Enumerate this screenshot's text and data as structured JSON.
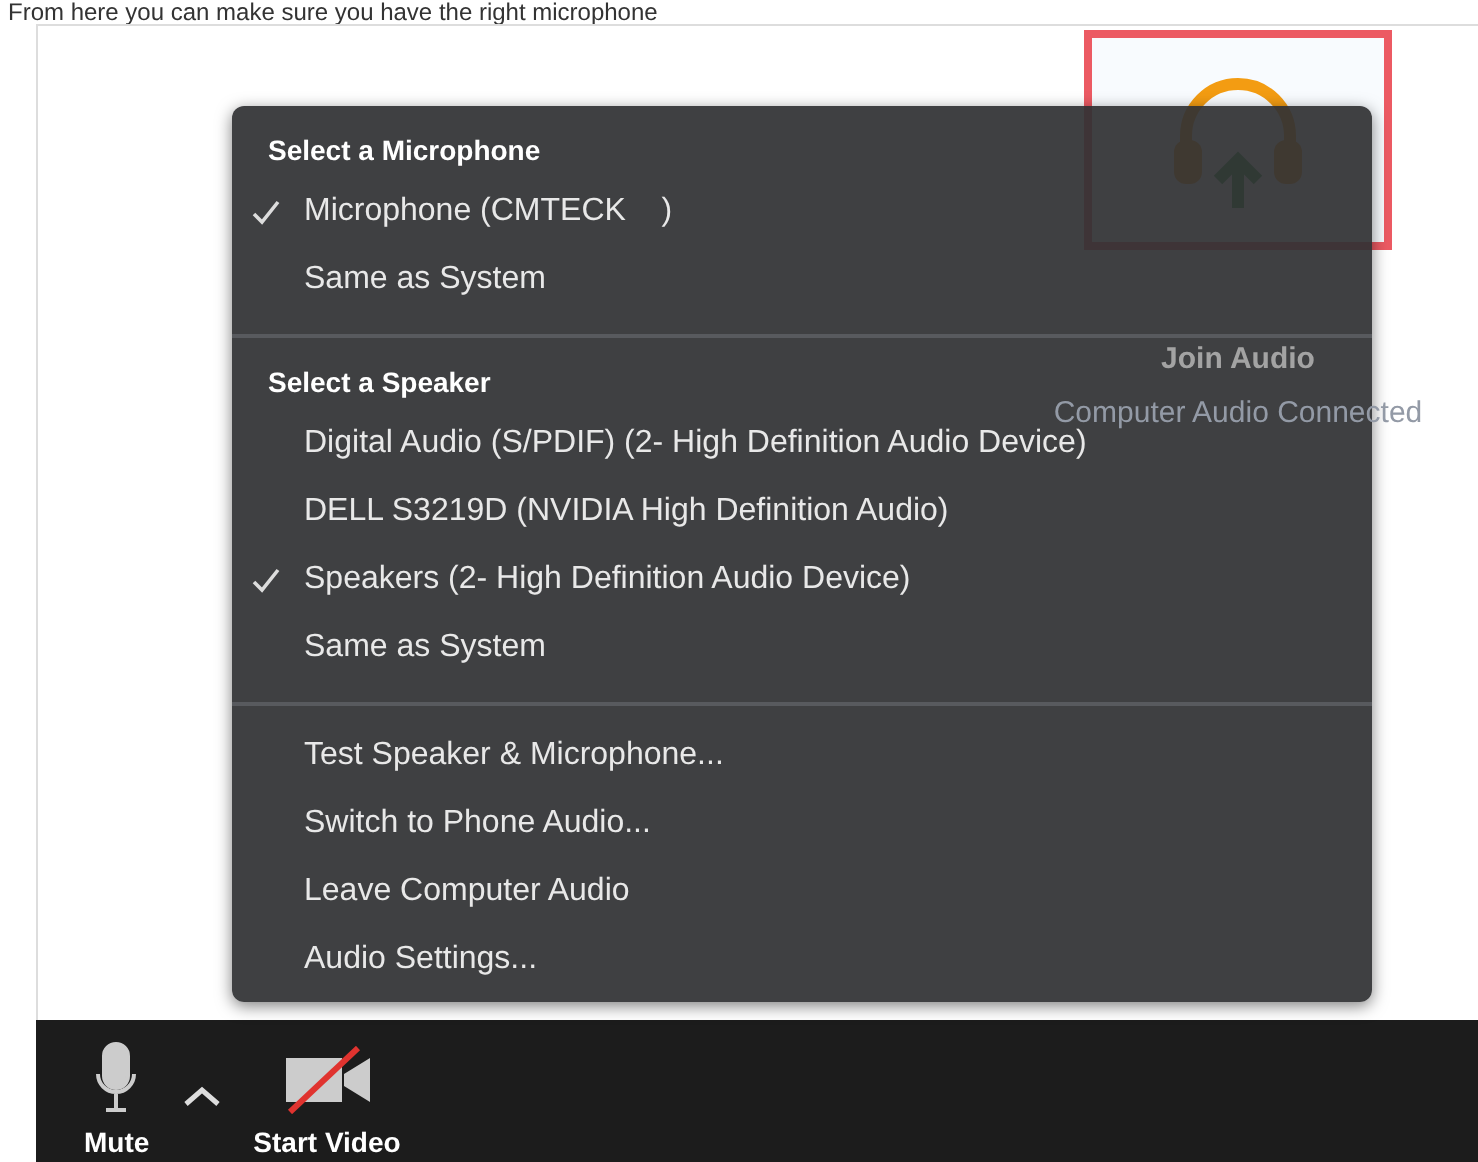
{
  "caption": "From here you can make sure you have the right microphone",
  "join_audio": {
    "title": "Join Audio",
    "status": "Computer Audio Connected"
  },
  "menu": {
    "sections": [
      {
        "header": "Select a Microphone",
        "items": [
          {
            "label": "Microphone (CMTECK    )",
            "checked": true
          },
          {
            "label": "Same as System",
            "checked": false
          }
        ]
      },
      {
        "header": "Select a Speaker",
        "items": [
          {
            "label": "Digital Audio (S/PDIF) (2- High Definition Audio Device)",
            "checked": false
          },
          {
            "label": "DELL S3219D (NVIDIA High Definition Audio)",
            "checked": false
          },
          {
            "label": "Speakers (2- High Definition Audio Device)",
            "checked": true
          },
          {
            "label": "Same as System",
            "checked": false
          }
        ]
      },
      {
        "items": [
          {
            "label": "Test Speaker & Microphone...",
            "checked": false
          },
          {
            "label": "Switch to Phone Audio...",
            "checked": false
          },
          {
            "label": "Leave Computer Audio",
            "checked": false
          },
          {
            "label": "Audio Settings...",
            "checked": false
          }
        ]
      }
    ]
  },
  "toolbar": [
    {
      "kind": "mic",
      "label": "Mute"
    },
    {
      "kind": "video-off",
      "label": "Start Video"
    }
  ]
}
